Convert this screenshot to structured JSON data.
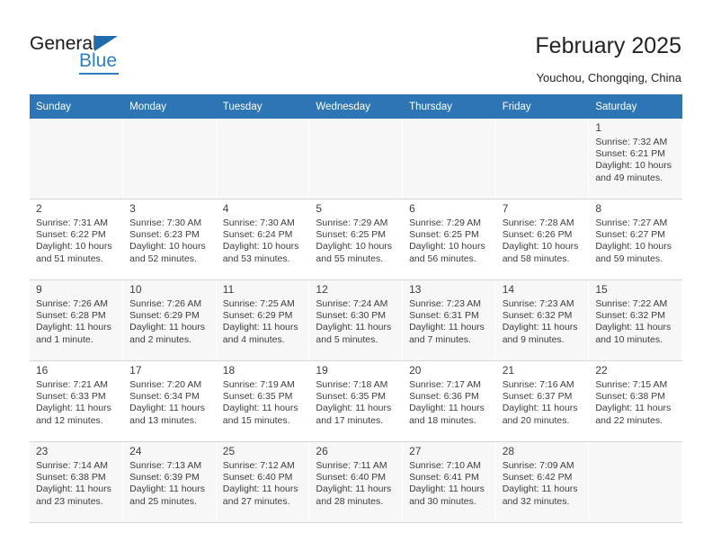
{
  "brand": {
    "name_top": "General",
    "name_bottom": "Blue",
    "accent_color": "#2a7fc9",
    "triangle_color": "#1f6cb0"
  },
  "header": {
    "title": "February 2025",
    "subtitle": "Youchou, Chongqing, China"
  },
  "theme": {
    "header_row_bg": "#2e75b6",
    "header_row_text": "#ffffff",
    "alt_row_bg": "#f7f7f7",
    "row_bg": "#ffffff",
    "text_color": "#3d3d3d"
  },
  "weekdays": [
    "Sunday",
    "Monday",
    "Tuesday",
    "Wednesday",
    "Thursday",
    "Friday",
    "Saturday"
  ],
  "labels": {
    "sunrise": "Sunrise:",
    "sunset": "Sunset:",
    "daylight": "Daylight:"
  },
  "weeks": [
    [
      {
        "empty": true
      },
      {
        "empty": true
      },
      {
        "empty": true
      },
      {
        "empty": true
      },
      {
        "empty": true
      },
      {
        "empty": true
      },
      {
        "day": "1",
        "sunrise": "Sunrise: 7:32 AM",
        "sunset": "Sunset: 6:21 PM",
        "daylight": "Daylight: 10 hours and 49 minutes."
      }
    ],
    [
      {
        "day": "2",
        "sunrise": "Sunrise: 7:31 AM",
        "sunset": "Sunset: 6:22 PM",
        "daylight": "Daylight: 10 hours and 51 minutes."
      },
      {
        "day": "3",
        "sunrise": "Sunrise: 7:30 AM",
        "sunset": "Sunset: 6:23 PM",
        "daylight": "Daylight: 10 hours and 52 minutes."
      },
      {
        "day": "4",
        "sunrise": "Sunrise: 7:30 AM",
        "sunset": "Sunset: 6:24 PM",
        "daylight": "Daylight: 10 hours and 53 minutes."
      },
      {
        "day": "5",
        "sunrise": "Sunrise: 7:29 AM",
        "sunset": "Sunset: 6:25 PM",
        "daylight": "Daylight: 10 hours and 55 minutes."
      },
      {
        "day": "6",
        "sunrise": "Sunrise: 7:29 AM",
        "sunset": "Sunset: 6:25 PM",
        "daylight": "Daylight: 10 hours and 56 minutes."
      },
      {
        "day": "7",
        "sunrise": "Sunrise: 7:28 AM",
        "sunset": "Sunset: 6:26 PM",
        "daylight": "Daylight: 10 hours and 58 minutes."
      },
      {
        "day": "8",
        "sunrise": "Sunrise: 7:27 AM",
        "sunset": "Sunset: 6:27 PM",
        "daylight": "Daylight: 10 hours and 59 minutes."
      }
    ],
    [
      {
        "day": "9",
        "sunrise": "Sunrise: 7:26 AM",
        "sunset": "Sunset: 6:28 PM",
        "daylight": "Daylight: 11 hours and 1 minute."
      },
      {
        "day": "10",
        "sunrise": "Sunrise: 7:26 AM",
        "sunset": "Sunset: 6:29 PM",
        "daylight": "Daylight: 11 hours and 2 minutes."
      },
      {
        "day": "11",
        "sunrise": "Sunrise: 7:25 AM",
        "sunset": "Sunset: 6:29 PM",
        "daylight": "Daylight: 11 hours and 4 minutes."
      },
      {
        "day": "12",
        "sunrise": "Sunrise: 7:24 AM",
        "sunset": "Sunset: 6:30 PM",
        "daylight": "Daylight: 11 hours and 5 minutes."
      },
      {
        "day": "13",
        "sunrise": "Sunrise: 7:23 AM",
        "sunset": "Sunset: 6:31 PM",
        "daylight": "Daylight: 11 hours and 7 minutes."
      },
      {
        "day": "14",
        "sunrise": "Sunrise: 7:23 AM",
        "sunset": "Sunset: 6:32 PM",
        "daylight": "Daylight: 11 hours and 9 minutes."
      },
      {
        "day": "15",
        "sunrise": "Sunrise: 7:22 AM",
        "sunset": "Sunset: 6:32 PM",
        "daylight": "Daylight: 11 hours and 10 minutes."
      }
    ],
    [
      {
        "day": "16",
        "sunrise": "Sunrise: 7:21 AM",
        "sunset": "Sunset: 6:33 PM",
        "daylight": "Daylight: 11 hours and 12 minutes."
      },
      {
        "day": "17",
        "sunrise": "Sunrise: 7:20 AM",
        "sunset": "Sunset: 6:34 PM",
        "daylight": "Daylight: 11 hours and 13 minutes."
      },
      {
        "day": "18",
        "sunrise": "Sunrise: 7:19 AM",
        "sunset": "Sunset: 6:35 PM",
        "daylight": "Daylight: 11 hours and 15 minutes."
      },
      {
        "day": "19",
        "sunrise": "Sunrise: 7:18 AM",
        "sunset": "Sunset: 6:35 PM",
        "daylight": "Daylight: 11 hours and 17 minutes."
      },
      {
        "day": "20",
        "sunrise": "Sunrise: 7:17 AM",
        "sunset": "Sunset: 6:36 PM",
        "daylight": "Daylight: 11 hours and 18 minutes."
      },
      {
        "day": "21",
        "sunrise": "Sunrise: 7:16 AM",
        "sunset": "Sunset: 6:37 PM",
        "daylight": "Daylight: 11 hours and 20 minutes."
      },
      {
        "day": "22",
        "sunrise": "Sunrise: 7:15 AM",
        "sunset": "Sunset: 6:38 PM",
        "daylight": "Daylight: 11 hours and 22 minutes."
      }
    ],
    [
      {
        "day": "23",
        "sunrise": "Sunrise: 7:14 AM",
        "sunset": "Sunset: 6:38 PM",
        "daylight": "Daylight: 11 hours and 23 minutes."
      },
      {
        "day": "24",
        "sunrise": "Sunrise: 7:13 AM",
        "sunset": "Sunset: 6:39 PM",
        "daylight": "Daylight: 11 hours and 25 minutes."
      },
      {
        "day": "25",
        "sunrise": "Sunrise: 7:12 AM",
        "sunset": "Sunset: 6:40 PM",
        "daylight": "Daylight: 11 hours and 27 minutes."
      },
      {
        "day": "26",
        "sunrise": "Sunrise: 7:11 AM",
        "sunset": "Sunset: 6:40 PM",
        "daylight": "Daylight: 11 hours and 28 minutes."
      },
      {
        "day": "27",
        "sunrise": "Sunrise: 7:10 AM",
        "sunset": "Sunset: 6:41 PM",
        "daylight": "Daylight: 11 hours and 30 minutes."
      },
      {
        "day": "28",
        "sunrise": "Sunrise: 7:09 AM",
        "sunset": "Sunset: 6:42 PM",
        "daylight": "Daylight: 11 hours and 32 minutes."
      },
      {
        "empty": true
      }
    ]
  ]
}
